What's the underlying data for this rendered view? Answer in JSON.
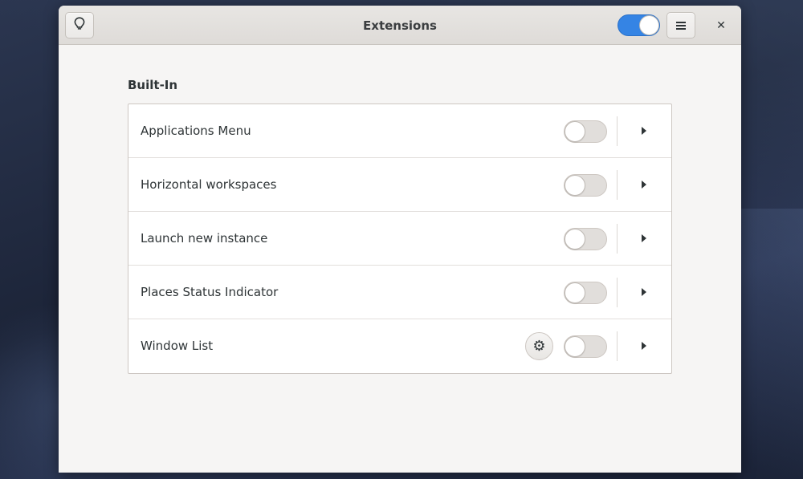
{
  "window": {
    "title": "Extensions",
    "global_switch_on": true,
    "icons": {
      "tips": "lightbulb-icon",
      "menu": "hamburger-menu-icon",
      "close": "close-icon"
    },
    "close_glyph": "✕"
  },
  "section": {
    "title": "Built-In"
  },
  "extensions": [
    {
      "name": "Applications Menu",
      "enabled": false,
      "has_settings": false
    },
    {
      "name": "Horizontal workspaces",
      "enabled": false,
      "has_settings": false
    },
    {
      "name": "Launch new instance",
      "enabled": false,
      "has_settings": false
    },
    {
      "name": "Places Status Indicator",
      "enabled": false,
      "has_settings": false
    },
    {
      "name": "Window List",
      "enabled": false,
      "has_settings": true,
      "settings_glyph": "⚙"
    }
  ],
  "colors": {
    "accent": "#3584e4",
    "window_bg": "#f6f5f4",
    "switch_off": "#e1dedb"
  }
}
